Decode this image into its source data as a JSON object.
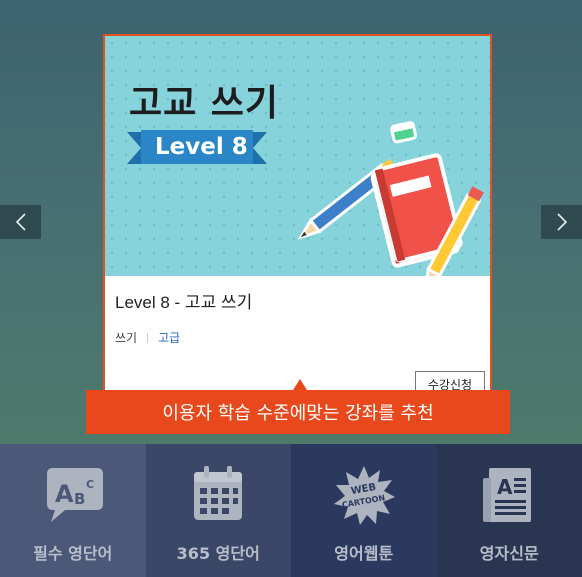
{
  "carousel": {
    "prev_icon": "chevron-left-icon",
    "next_icon": "chevron-right-icon"
  },
  "card": {
    "thumbnail": {
      "title": "고교 쓰기",
      "level_badge": "Level 8"
    },
    "course_title": "Level 8 - 고교 쓰기",
    "category": "쓰기",
    "level_tag": "고급",
    "apply_label": "수강신청",
    "accent_color": "#e5521f"
  },
  "tooltip": {
    "text": "이용자 학습 수준에맞는 강좌를 추천",
    "color": "#e8481c"
  },
  "menu": {
    "items": [
      {
        "label": "필수 영단어",
        "icon": "abc-speech-bubble-icon"
      },
      {
        "label": "365 영단어",
        "icon": "calendar-icon"
      },
      {
        "label": "영어웹툰",
        "icon": "web-cartoon-icon"
      },
      {
        "label": "영자신문",
        "icon": "newspaper-icon"
      }
    ]
  }
}
